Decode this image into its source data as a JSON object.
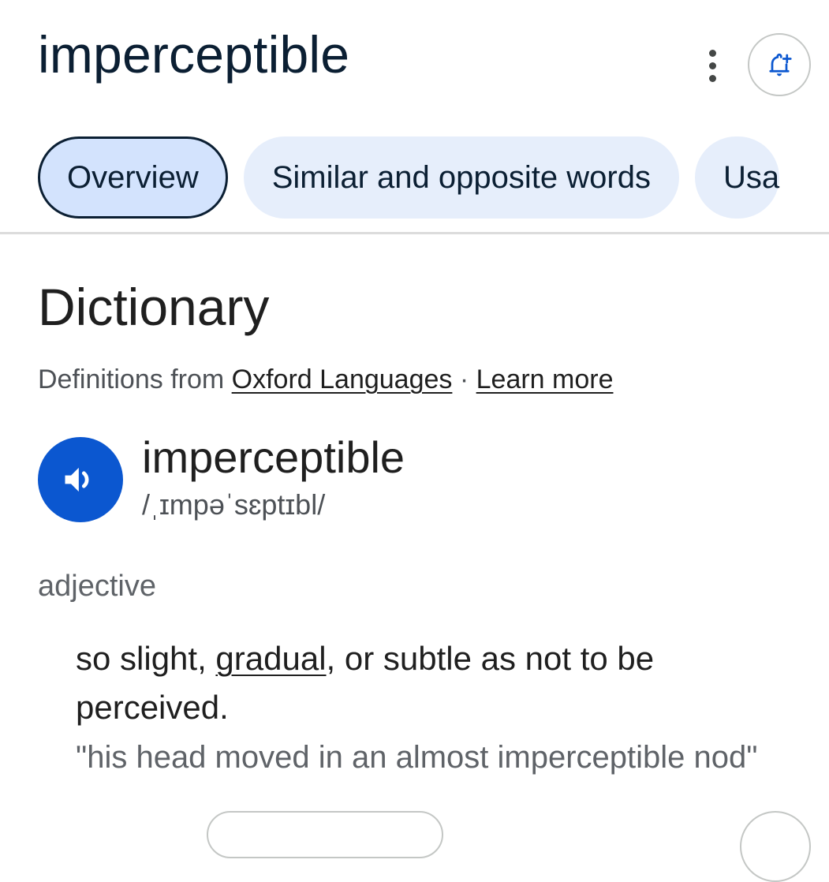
{
  "header": {
    "title": "imperceptible",
    "more_icon": "more-vert-icon",
    "alert_icon": "add-alert-icon"
  },
  "tabs": [
    {
      "label": "Overview",
      "active": true
    },
    {
      "label": "Similar and opposite words",
      "active": false
    },
    {
      "label": "Usa",
      "active": false
    }
  ],
  "dictionary": {
    "section_title": "Dictionary",
    "source_prefix": "Definitions from ",
    "source_link": "Oxford Languages",
    "separator": " · ",
    "learn_more": "Learn more",
    "speaker_icon": "volume-icon",
    "headword": "imperceptible",
    "phonetic": "/ˌɪmpəˈsɛptɪbl/",
    "part_of_speech": "adjective",
    "definition_before": "so slight, ",
    "definition_link": "gradual",
    "definition_after": ", or subtle as not to be perceived.",
    "example": "\"his head moved in an almost imperceptible nod\""
  },
  "colors": {
    "accent": "#0b57d0",
    "active_tab_bg": "#d3e3fd",
    "tab_bg": "#e6eefb",
    "title_text": "#0b1f33"
  }
}
